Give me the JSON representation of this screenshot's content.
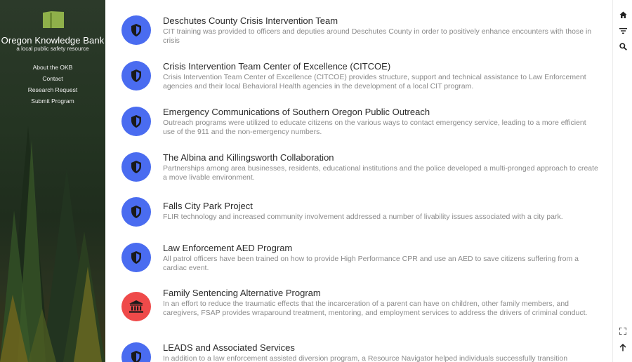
{
  "sidebar": {
    "brand": "Oregon Knowledge Bank",
    "tagline": "a local public safety resource",
    "nav": [
      "About the OKB",
      "Contact",
      "Research Request",
      "Submit Program"
    ]
  },
  "colors": {
    "badge_blue": "#4a6cf0",
    "badge_red": "#ef4a4a"
  },
  "programs": [
    {
      "title": "Deschutes County Crisis Intervention Team",
      "description": "CIT training was provided to officers and deputies around Deschutes County in order to positively enhance encounters with those in crisis",
      "icon": "shield-icon"
    },
    {
      "title": "Crisis Intervention Team Center of Excellence (CITCOE)",
      "description": "Crisis Intervention Team Center of Excellence (CITCOE) provides structure, support and technical assistance to Law Enforcement agencies and their local Behavioral Health agencies in the development of a local CIT program.",
      "icon": "shield-icon"
    },
    {
      "title": "Emergency Communications of Southern Oregon Public Outreach",
      "description": "Outreach programs were utilized to educate citizens on the various ways to contact emergency service, leading to a more efficient use of the 911 and the non-emergency numbers.",
      "icon": "shield-icon"
    },
    {
      "title": "The Albina and Killingsworth Collaboration",
      "description": "Partnerships among area businesses, residents, educational institutions and the police developed a multi-pronged approach to create a move livable environment.",
      "icon": "shield-icon"
    },
    {
      "title": "Falls City Park Project",
      "description": "FLIR technology and increased community involvement addressed a number of livability issues associated with a city park.",
      "icon": "shield-icon"
    },
    {
      "title": "Law Enforcement AED Program",
      "description": "All patrol officers have been trained on how to provide High Performance CPR and use an AED to save citizens suffering from a cardiac event.",
      "icon": "shield-icon"
    },
    {
      "title": "Family Sentencing Alternative Program",
      "description": "In an effort to reduce the traumatic effects that the incarceration of a parent can have on children, other family members, and caregivers, FSAP provides wraparound treatment, mentoring, and employment services to address the drivers of criminal conduct.",
      "icon": "courthouse-icon"
    },
    {
      "title": "LEADS and Associated Services",
      "description": "In addition to a law enforcement assisted diversion program, a Resource Navigator helped individuals successfully transition",
      "icon": "shield-icon"
    }
  ],
  "rail": {
    "icons": [
      "home-icon",
      "filter-icon",
      "search-icon",
      "fullscreen-icon",
      "arrow-up-icon"
    ]
  }
}
